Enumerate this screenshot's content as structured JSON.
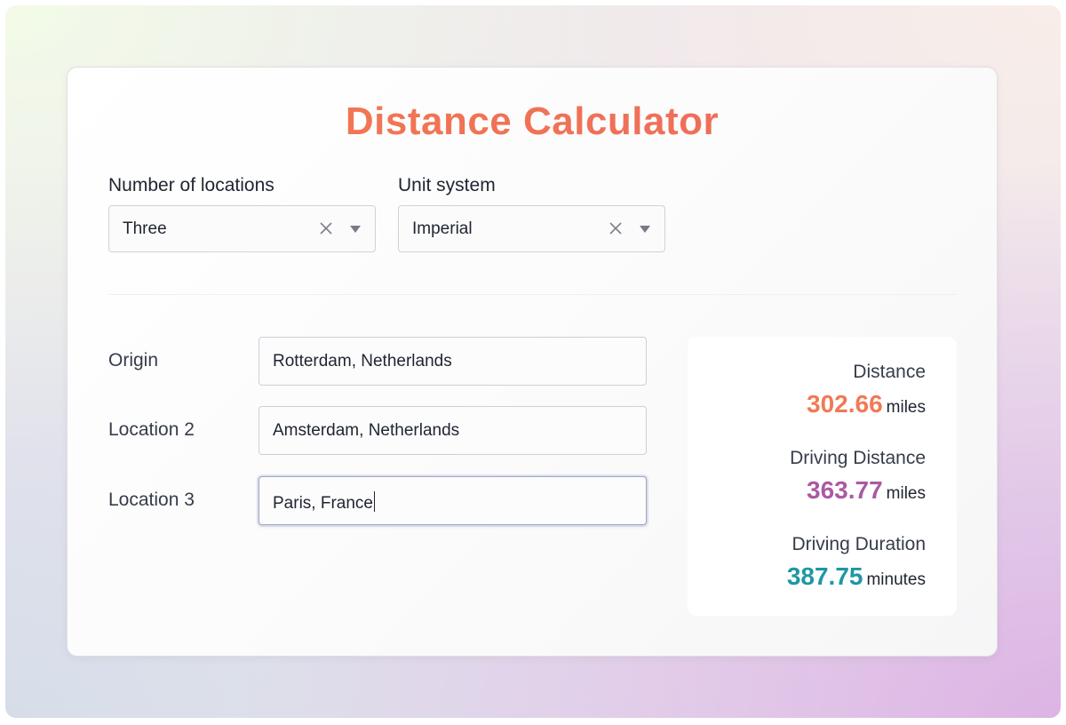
{
  "app": {
    "title": "Distance Calculator",
    "accent_color": "#f0705a"
  },
  "controls": {
    "locations_count": {
      "label": "Number of locations",
      "value": "Three",
      "clear_icon": "close-icon",
      "dropdown_icon": "chevron-down-icon"
    },
    "unit_system": {
      "label": "Unit system",
      "value": "Imperial",
      "clear_icon": "close-icon",
      "dropdown_icon": "chevron-down-icon"
    }
  },
  "locations": [
    {
      "label": "Origin",
      "value": "Rotterdam, Netherlands"
    },
    {
      "label": "Location 2",
      "value": "Amsterdam, Netherlands"
    },
    {
      "label": "Location 3",
      "value": "Paris, France",
      "focused": true
    }
  ],
  "results": {
    "distance": {
      "label": "Distance",
      "value": "302.66",
      "unit": "miles",
      "color": "#f07a55"
    },
    "driving_distance": {
      "label": "Driving Distance",
      "value": "363.77",
      "unit": "miles",
      "color": "#a95aa3"
    },
    "driving_duration": {
      "label": "Driving Duration",
      "value": "387.75",
      "unit": "minutes",
      "color": "#1e97a3"
    }
  }
}
